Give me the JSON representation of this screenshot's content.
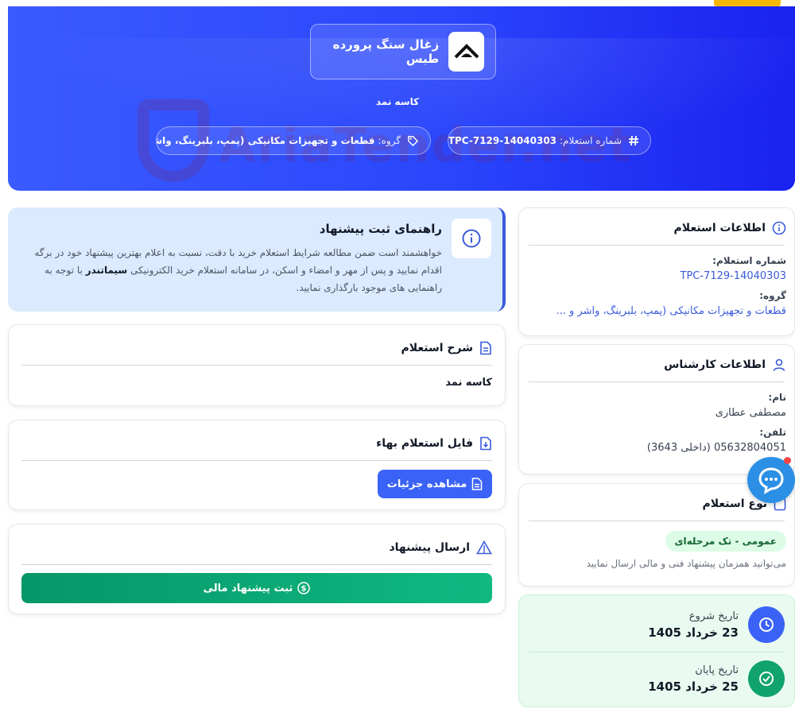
{
  "header": {
    "company_name": "زغال سنگ پرورده طبس",
    "subject": "کاسه نمد",
    "inquiry_number_label": "شماره استعلام:",
    "inquiry_number": "TPC-7129-14040303",
    "group_label": "گروه:",
    "group_value": "قطعات و تجهیزات مکانیکی (پمپ، بلبرینگ، واشر و ...",
    "watermark": "AriaTender.net"
  },
  "inquiry_info": {
    "title": "اطلاعات استعلام",
    "number_label": "شماره استعلام:",
    "number_value": "TPC-7129-14040303",
    "group_label": "گروه:",
    "group_value": "قطعات و تجهیزات مکانیکی (پمپ، بلبرینگ، واشر و ..."
  },
  "expert_info": {
    "title": "اطلاعات کارشناس",
    "name_label": "نام:",
    "name_value": "مصطفی عطاری",
    "phone_label": "تلفن:",
    "phone_value": "05632804051 (داخلی 3643)"
  },
  "inquiry_type": {
    "title": "نوع استعلام",
    "badge": "عمومی - تک مرحله‌ای",
    "note": "می‌توانید همزمان پیشنهاد فنی و مالی ارسال نمایید"
  },
  "dates": {
    "start_label": "تاریخ شروع",
    "start_value": "23 خرداد 1405",
    "end_label": "تاریخ پایان",
    "end_value": "25 خرداد 1405"
  },
  "guide": {
    "title": "راهنمای ثبت پیشنهاد",
    "text_before": "خواهشمند است ضمن مطالعه شرایط استعلام خرید با دقت، نسبت به اعلام بهترین پیشنهاد خود در برگه اقدام نمایید و پس از مهر و امضاء و اسکن، در سامانه استعلام خرید الکترونیکی ",
    "text_bold": "سیماتندر",
    "text_after": " با توجه به راهنمایی های موجود بارگذاری نمایید."
  },
  "description": {
    "title": "شرح استعلام",
    "body": "کاسه نمد"
  },
  "price_file": {
    "title": "فایل استعلام بهاء",
    "button": "مشاهده جزئیات"
  },
  "send_offer": {
    "title": "ارسال پیشنهاد",
    "button": "ثبت پیشنهاد مالی"
  },
  "colors": {
    "primary": "#3b62f6",
    "header_start": "#3a5bff",
    "header_end": "#1a22f0",
    "success": "#10b981",
    "accent": "#f5b800"
  }
}
